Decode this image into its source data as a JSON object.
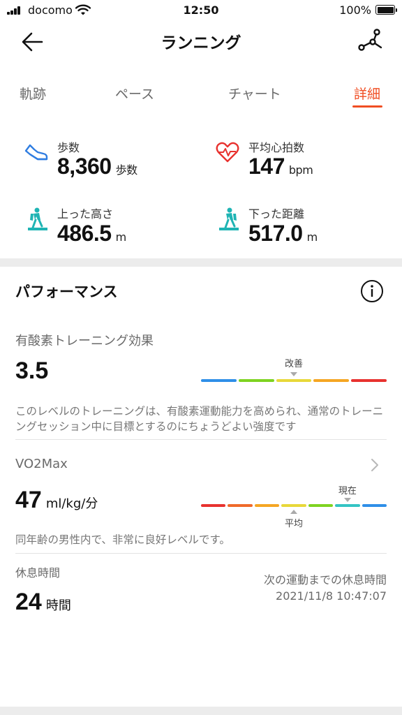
{
  "status_bar": {
    "carrier": "docomo",
    "time": "12:50",
    "battery": "100%"
  },
  "header": {
    "title": "ランニング",
    "back_icon": "arrow-left-icon",
    "share_icon": "route-share-icon"
  },
  "tabs": [
    {
      "label": "軌跡",
      "active": false
    },
    {
      "label": "ペース",
      "active": false
    },
    {
      "label": "チャート",
      "active": false
    },
    {
      "label": "詳細",
      "active": true
    }
  ],
  "stats": {
    "steps": {
      "label": "歩数",
      "value": "8,360",
      "unit": "歩数",
      "icon": "shoe-icon"
    },
    "heart_rate": {
      "label": "平均心拍数",
      "value": "147",
      "unit": "bpm",
      "icon": "heart-rate-icon"
    },
    "ascent": {
      "label": "上った高さ",
      "value": "486.5",
      "unit": "m",
      "icon": "hiker-up-icon"
    },
    "descent": {
      "label": "下った距離",
      "value": "517.0",
      "unit": "m",
      "icon": "hiker-down-icon"
    }
  },
  "performance": {
    "title": "パフォーマンス",
    "info_icon": "info-icon",
    "aerobic": {
      "label": "有酸素トレーニング効果",
      "value": "3.5",
      "marker_label": "改善",
      "marker_segment": 2,
      "segment_colors": [
        "#2f8fe8",
        "#7ed321",
        "#e8d83a",
        "#f5a623",
        "#e8322f"
      ],
      "description": "このレベルのトレーニングは、有酸素運動能力を高められ、通常のトレーニングセッション中に目標とするのにちょうどよい強度です"
    },
    "vo2max": {
      "label": "VO2Max",
      "value": "47",
      "unit": "ml/kg/分",
      "current_label": "現在",
      "current_segment": 5,
      "average_label": "平均",
      "average_segment": 3,
      "segment_colors": [
        "#e8322f",
        "#f06a2a",
        "#f5a623",
        "#e8d83a",
        "#7ed321",
        "#34c4c4",
        "#2f8fe8"
      ],
      "description": "同年齢の男性内で、非常に良好レベルです。"
    },
    "rest": {
      "label": "休息時間",
      "value": "24",
      "unit": "時間",
      "next_label": "次の運動までの休息時間",
      "next_time": "2021/11/8 10:47:07"
    }
  }
}
